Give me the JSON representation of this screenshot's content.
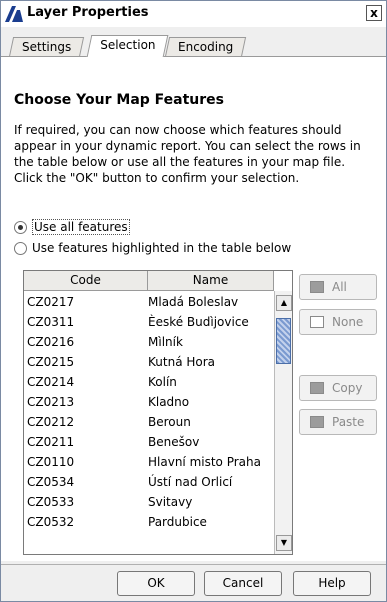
{
  "window": {
    "title": "Layer Properties",
    "close_glyph": "x"
  },
  "tabs": [
    {
      "label": "Settings",
      "active": false
    },
    {
      "label": "Selection",
      "active": true
    },
    {
      "label": "Encoding",
      "active": false
    }
  ],
  "panel": {
    "heading": "Choose Your Map Features",
    "intro": "If required, you can now choose which features should appear in your dynamic report. You can select the rows in the table below or use all the features in your map file. Click the \"OK\" button to confirm your selection."
  },
  "radios": [
    {
      "label": "Use all features",
      "checked": true
    },
    {
      "label": "Use features highlighted in the table below",
      "checked": false
    }
  ],
  "table": {
    "columns": [
      "Code",
      "Name"
    ],
    "rows": [
      [
        "CZ0217",
        "Mladá Boleslav"
      ],
      [
        "CZ0311",
        "Èeské Budìjovice"
      ],
      [
        "CZ0216",
        "Mìlník"
      ],
      [
        "CZ0215",
        "Kutná Hora"
      ],
      [
        "CZ0214",
        "Kolín"
      ],
      [
        "CZ0213",
        "Kladno"
      ],
      [
        "CZ0212",
        "Beroun"
      ],
      [
        "CZ0211",
        "Benešov"
      ],
      [
        "CZ0110",
        "Hlavní misto Praha"
      ],
      [
        "CZ0534",
        "Ústí nad Orlicí"
      ],
      [
        "CZ0533",
        "Svitavy"
      ],
      [
        "CZ0532",
        "Pardubice"
      ]
    ]
  },
  "side_buttons": {
    "all": "All",
    "none": "None",
    "copy": "Copy",
    "paste": "Paste"
  },
  "footer": {
    "ok": "OK",
    "cancel": "Cancel",
    "help": "Help"
  }
}
